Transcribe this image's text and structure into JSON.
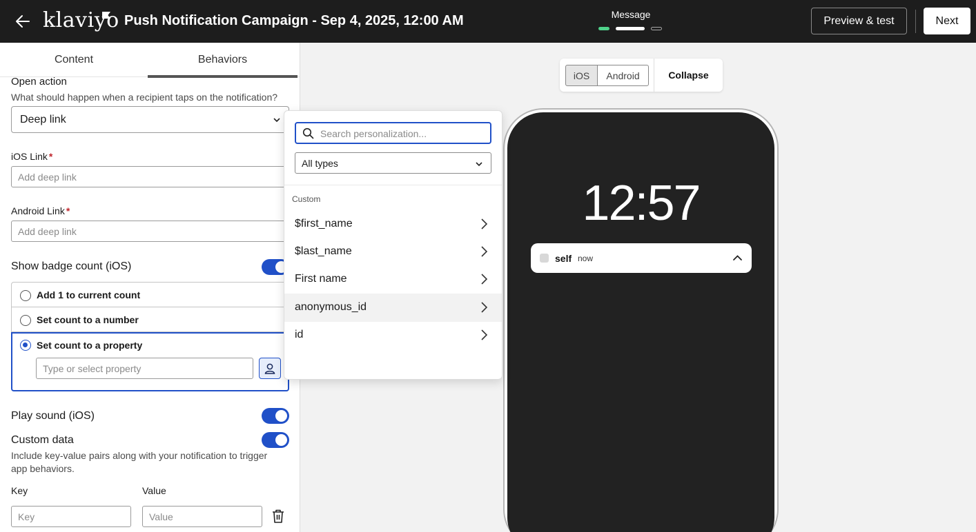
{
  "topbar": {
    "logo": "klaviyo",
    "title": "Push Notification Campaign - Sep 4, 2025, 12:00 AM",
    "step_label": "Message",
    "preview_button": "Preview & test",
    "next_button": "Next"
  },
  "tabs": [
    {
      "label": "Content",
      "active": false
    },
    {
      "label": "Behaviors",
      "active": true
    }
  ],
  "behaviors": {
    "open_action_label": "Open action",
    "open_action_help": "What should happen when a recipient taps on the notification?",
    "open_action_value": "Deep link",
    "ios_link_label": "iOS Link",
    "ios_link_placeholder": "Add deep link",
    "android_link_label": "Android Link",
    "android_link_placeholder": "Add deep link",
    "required_mark": "*",
    "badge_label": "Show badge count (iOS)",
    "badge_enabled": true,
    "badge_options": [
      {
        "label": "Add 1 to current count",
        "selected": false
      },
      {
        "label": "Set count to a number",
        "selected": false
      },
      {
        "label": "Set count to a property",
        "selected": true
      }
    ],
    "property_placeholder": "Type or select property",
    "play_sound_label": "Play sound (iOS)",
    "play_sound_enabled": true,
    "custom_data_label": "Custom data",
    "custom_data_enabled": true,
    "custom_data_help_1": "Include key-value pairs along with your notification to trigger",
    "custom_data_help_2": "app behaviors.",
    "key_label": "Key",
    "value_label": "Value",
    "key_placeholder": "Key",
    "value_placeholder": "Value"
  },
  "preview": {
    "platform_ios": "iOS",
    "platform_android": "Android",
    "selected_platform": "iOS",
    "collapse_label": "Collapse",
    "clock": "12:57",
    "notification_sender": "self",
    "notification_time": "now"
  },
  "personalization": {
    "search_placeholder": "Search personalization...",
    "type_filter": "All types",
    "category": "Custom",
    "items": [
      "$first_name",
      "$last_name",
      "First name",
      "anonymous_id",
      "id"
    ],
    "highlighted_item": "anonymous_id"
  },
  "colors": {
    "accent": "#2050c8",
    "topbar": "#1d1d1d",
    "step_done": "#4fd28a",
    "required": "#c0262d"
  }
}
